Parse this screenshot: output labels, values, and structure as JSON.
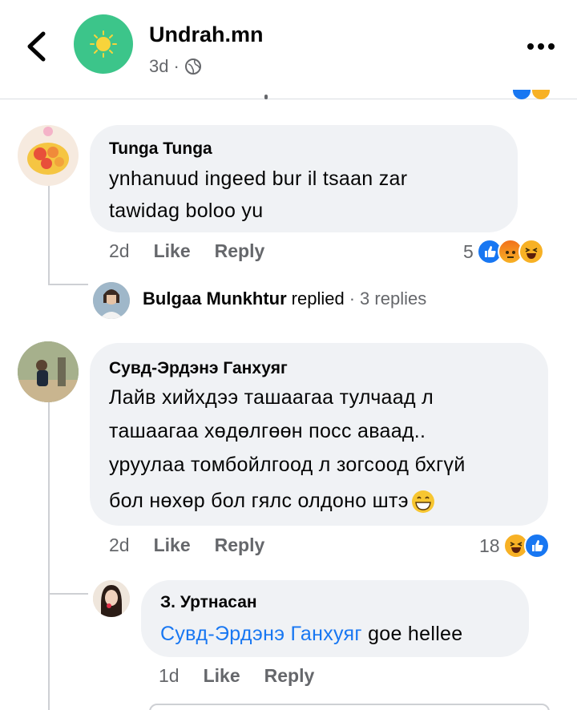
{
  "header": {
    "page_name": "Undrah.mn",
    "time": "3d",
    "separator": "·"
  },
  "comments": [
    {
      "author": "Tunga Tunga",
      "text_line1": "ynhanuud   ingeed  bur  il  tsaan   zar",
      "text_line2": "tawidag boloo  yu",
      "time": "2d",
      "like": "Like",
      "reply": "Reply",
      "reaction_count": "5",
      "reactions": [
        "like-icon",
        "angry-icon",
        "haha-icon"
      ],
      "replies_summary": {
        "name": "Bulgaa Munkhtur",
        "replied": "replied",
        "separator": "·",
        "count": "3 replies"
      }
    },
    {
      "author": "Сувд-Эрдэнэ Ганхуяг",
      "text_line1": "Лайв хийхдээ ташаагаа тулчаад л",
      "text_line2": "ташаагаа хөдөлгөөн посс аваад..",
      "text_line3": "уруулаа томбойлгоод л зогсоод бхгүй",
      "text_line4": "бол нөхөр бол гялс олдоно штэ",
      "time": "2d",
      "like": "Like",
      "reply": "Reply",
      "reaction_count": "18",
      "reactions": [
        "haha-icon",
        "like-icon"
      ]
    }
  ],
  "reply": {
    "author": "З. Уртнасан",
    "mention": "Сувд-Эрдэнэ Ганхуяг",
    "text": " goe hellee",
    "time": "1d",
    "like": "Like",
    "reply": "Reply"
  },
  "colors": {
    "accent": "#1877f2",
    "bubble": "#f0f2f5",
    "muted": "#65676b"
  }
}
